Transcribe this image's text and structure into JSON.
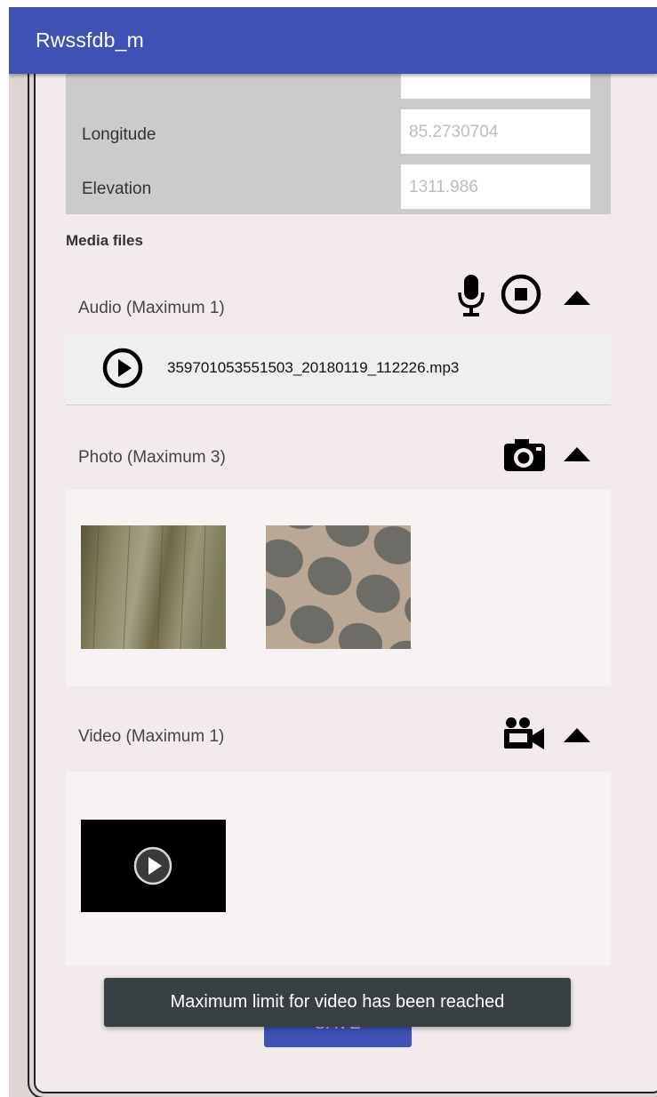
{
  "app": {
    "title": "Rwssfdb_m"
  },
  "location": {
    "longitude_label": "Longitude",
    "longitude_value": "85.2730704",
    "elevation_label": "Elevation",
    "elevation_value": "1311.986"
  },
  "media": {
    "title": "Media files",
    "audio": {
      "label": "Audio (Maximum 1)",
      "file_name": "359701053551503_20180119_112226.mp3",
      "icons": [
        "microphone-icon",
        "stop-record-icon",
        "collapse-arrow-icon",
        "play-icon"
      ]
    },
    "photo": {
      "label": "Photo (Maximum 3)",
      "icons": [
        "camera-icon",
        "collapse-arrow-icon"
      ]
    },
    "video": {
      "label": "Video (Maximum 1)",
      "icons": [
        "video-camera-icon",
        "collapse-arrow-icon",
        "play-icon"
      ]
    }
  },
  "save_label": "SAVE",
  "toast": {
    "message": "Maximum limit for video has been reached"
  },
  "colors": {
    "appbar": "#3f51b5",
    "toast": "#394043",
    "card": "#f3ebeb",
    "gray_block": "#cbcbcb"
  }
}
